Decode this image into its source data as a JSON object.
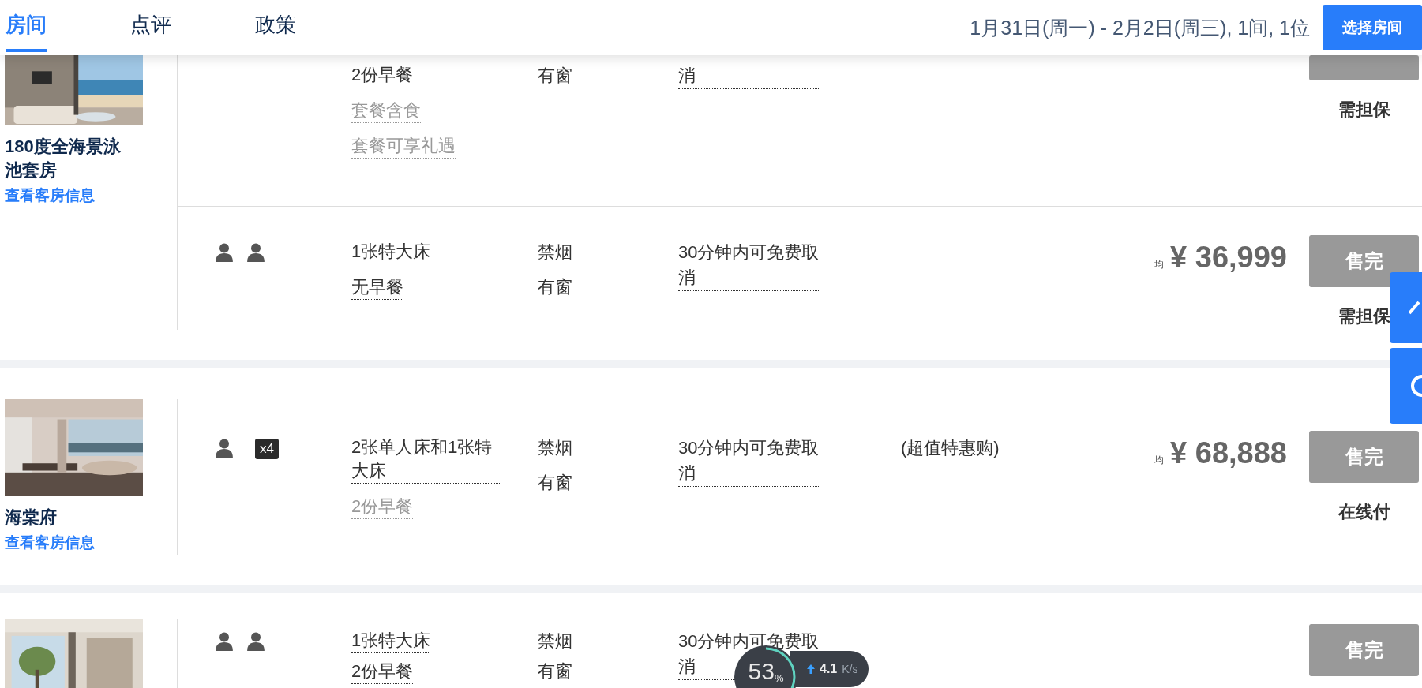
{
  "header": {
    "tabs": [
      {
        "label": "房间",
        "selected": true
      },
      {
        "label": "点评",
        "selected": false
      },
      {
        "label": "政策",
        "selected": false
      }
    ],
    "stay": "1月31日(周一) - 2月2日(周三), 1间, 1位",
    "select_button": "选择房间"
  },
  "groups": [
    {
      "image": {
        "kind": "picture"
      },
      "name": "180度全海景泳池套房",
      "link": "查看客房信息",
      "rooms": [
        {
          "beds": [
            {
              "text": "2份早餐",
              "muted": false,
              "dotted": false
            },
            {
              "text": "套餐含食",
              "muted": true,
              "dotted": true
            },
            {
              "text": "套餐可享礼遇",
              "muted": true,
              "dotted": true
            }
          ],
          "policies": [
            "有窗"
          ],
          "cancellation": "消",
          "button": {
            "sold_out": true
          },
          "payment": "需担保"
        },
        {
          "guests": [
            {
              "kind": "person"
            },
            {
              "kind": "person"
            }
          ],
          "beds": [
            {
              "text": "1张特大床",
              "muted": false,
              "dotted": true
            },
            {
              "text": "无早餐",
              "muted": false,
              "dotted": true
            }
          ],
          "policies": [
            "禁烟",
            "有窗"
          ],
          "cancellation": "30分钟内可免费取消",
          "price": {
            "prefix": "均",
            "amount": "¥ 36,999"
          },
          "button": {
            "label": "售完",
            "sold_out": true
          },
          "payment": "需担保"
        }
      ]
    },
    {
      "image": {
        "kind": "picture"
      },
      "name": "海棠府",
      "link": "查看客房信息",
      "rooms": [
        {
          "guests": [
            {
              "kind": "person"
            },
            {
              "kind": "count",
              "text": "x4"
            }
          ],
          "beds": [
            {
              "text": "2张单人床和1张特大床",
              "muted": false,
              "dotted": true
            },
            {
              "text": "2份早餐",
              "muted": true,
              "dotted": true
            }
          ],
          "policies": [
            "禁烟",
            "有窗"
          ],
          "cancellation": "30分钟内可免费取消",
          "offer": "(超值特惠购)",
          "price": {
            "prefix": "均",
            "amount": "¥ 68,888"
          },
          "button": {
            "label": "售完",
            "sold_out": true
          },
          "payment": "在线付"
        }
      ]
    },
    {
      "image": {
        "kind": "picture"
      },
      "rooms": [
        {
          "guests": [
            {
              "kind": "person"
            },
            {
              "kind": "person"
            }
          ],
          "beds": [
            {
              "text": "1张特大床",
              "muted": false,
              "dotted": true
            },
            {
              "text": "2份早餐",
              "muted": false,
              "dotted": true
            }
          ],
          "policies": [
            "禁烟",
            "有窗"
          ],
          "cancellation": "30分钟内可免费取消",
          "button": {
            "label": "售完",
            "sold_out": true
          }
        }
      ]
    }
  ],
  "net_widget": {
    "percent": "53",
    "percent_unit": "%",
    "speed": "4.1",
    "speed_unit": "K/s"
  }
}
